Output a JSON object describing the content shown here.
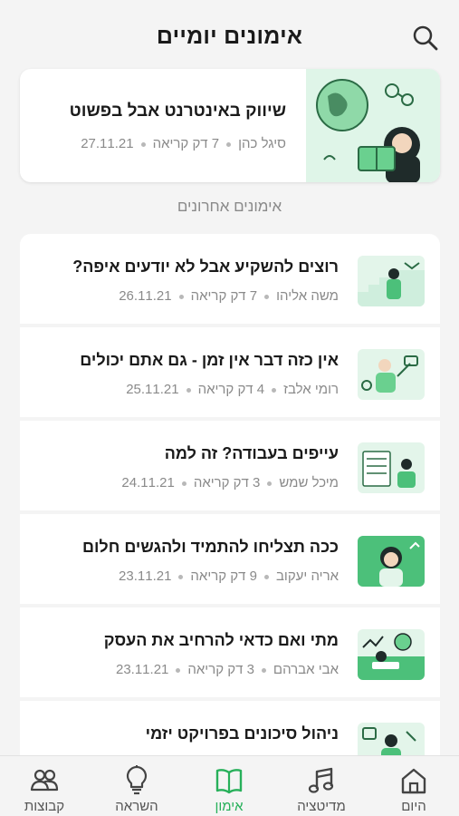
{
  "header": {
    "title": "אימונים יומיים"
  },
  "featured": {
    "title": "שיווק באינטרנט אבל בפשוט",
    "author": "סיגל כהן",
    "read_time": "7 דק קריאה",
    "date": "27.11.21"
  },
  "section_label": "אימונים אחרונים",
  "items": [
    {
      "title": "רוצים להשקיע אבל לא יודעים איפה?",
      "author": "משה אליהו",
      "read_time": "7 דק קריאה",
      "date": "26.11.21"
    },
    {
      "title": "אין כזה דבר אין זמן - גם אתם יכולים",
      "author": "רומי אלבז",
      "read_time": "4 דק קריאה",
      "date": "25.11.21"
    },
    {
      "title": "עייפים בעבודה? זה למה",
      "author": "מיכל שמש",
      "read_time": "3 דק קריאה",
      "date": "24.11.21"
    },
    {
      "title": "ככה תצליחו להתמיד ולהגשים חלום",
      "author": "אריה יעקוב",
      "read_time": "9 דק קריאה",
      "date": "23.11.21"
    },
    {
      "title": "מתי ואם כדאי להרחיב את העסק",
      "author": "אבי אברהם",
      "read_time": "3 דק קריאה",
      "date": "23.11.21"
    },
    {
      "title": "ניהול סיכונים בפרויקט יזמי",
      "author": "",
      "read_time": "",
      "date": ""
    }
  ],
  "nav": {
    "home": "היום",
    "meditation": "מדיטציה",
    "training": "אימון",
    "inspiration": "השראה",
    "groups": "קבוצות"
  },
  "colors": {
    "accent": "#27b05a",
    "thumb_bg": "#e3f5ea",
    "text": "#1a1a1a",
    "muted": "#8a8a8a"
  }
}
